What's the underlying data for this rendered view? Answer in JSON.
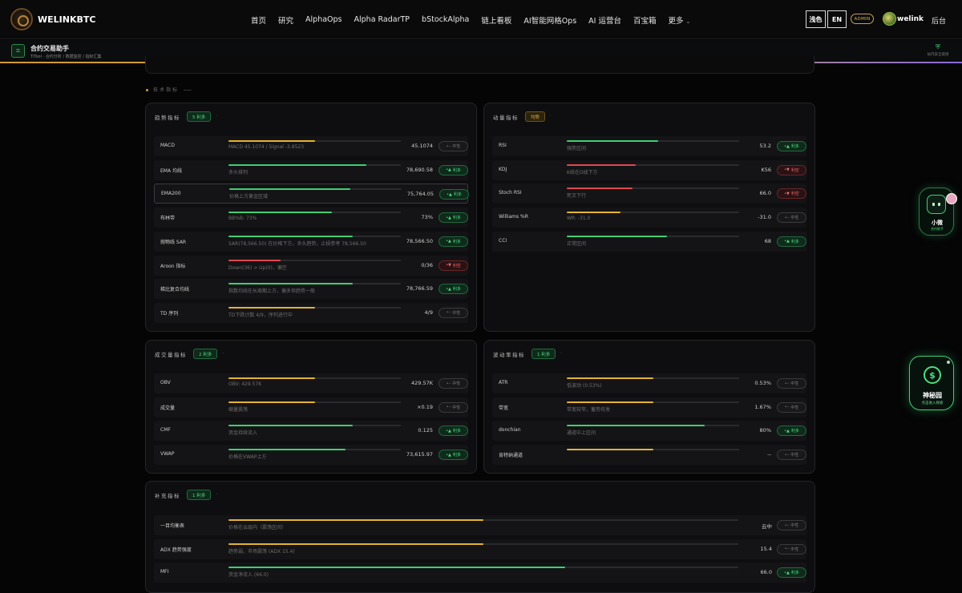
{
  "header": {
    "logo_text": "WELINKBTC",
    "nav": [
      "首页",
      "研究",
      "AlphaOps",
      "Alpha RadarTP",
      "bStockAlpha",
      "链上看板",
      "AI智能网格Ops",
      "AI 运营台",
      "百宝箱",
      "更多"
    ],
    "theme_btn": "浅色",
    "lang_btn": "EN",
    "admin_badge": "ADMIN",
    "username": "welink",
    "backend_link": "后台"
  },
  "subheader": {
    "title": "合约交易助手",
    "breadcrumb": "TiTool · 合约分析 / 数据监控 / 指标汇集",
    "secure_text": "站内安全链接"
  },
  "section_label": "技术指标",
  "cards": {
    "trend": {
      "title": "趋势指标",
      "pill": "5 利多",
      "rows": [
        {
          "name": "MACD",
          "desc": "MACD 45.1074 / Signal -3.8523",
          "value": "45.1074",
          "badge": "中性",
          "sentiment": "neutral",
          "fill": 0.5,
          "color": "#e5b32e",
          "hl": false
        },
        {
          "name": "EMA 均线",
          "desc": "多头排列",
          "value": "78,690.58",
          "badge": "利多",
          "sentiment": "bull",
          "fill": 0.8,
          "color": "#3ecf74",
          "hl": false
        },
        {
          "name": "EMA200",
          "desc": "价格上方黄金区域",
          "value": "75,764.05",
          "badge": "利多",
          "sentiment": "bull",
          "fill": 0.7,
          "color": "#3ecf74",
          "hl": true
        },
        {
          "name": "布林带",
          "desc": "BB%B: 73%",
          "value": "73%",
          "badge": "利多",
          "sentiment": "bull",
          "fill": 0.6,
          "color": "#3ecf74",
          "hl": false
        },
        {
          "name": "抛物线 SAR",
          "desc": "SAR(78,566.50) 在价格下方，多头趋势，止损参考 78,566.50",
          "value": "78,566.50",
          "badge": "利多",
          "sentiment": "bull",
          "fill": 0.72,
          "color": "#3ecf74",
          "hl": false
        },
        {
          "name": "Aroon 指标",
          "desc": "Down(36) > Up(0)，偏空",
          "value": "0/36",
          "badge": "利空",
          "sentiment": "bear",
          "fill": 0.3,
          "color": "#e0484f",
          "hl": false
        },
        {
          "name": "梯比复合均线",
          "desc": "指数均线在长周期上方，偏多但趋势一般",
          "value": "78,766.59",
          "badge": "利多",
          "sentiment": "bull",
          "fill": 0.72,
          "color": "#3ecf74",
          "hl": false
        },
        {
          "name": "TD 序列",
          "desc": "TD下跌计数 4/9，序列进行中",
          "value": "4/9",
          "badge": "中性",
          "sentiment": "neutral",
          "fill": 0.5,
          "color": "#e5b32e",
          "hl": false
        }
      ]
    },
    "momentum": {
      "title": "动量指标",
      "pill": "均势",
      "rows": [
        {
          "name": "RSI",
          "desc": "强势区间",
          "value": "53.2",
          "badge": "利多",
          "sentiment": "bull",
          "fill": 0.53,
          "color": "#3ecf74",
          "hl": false
        },
        {
          "name": "KDJ",
          "desc": "K线在D线下方",
          "value": "K56",
          "badge": "利空",
          "sentiment": "bear",
          "fill": 0.4,
          "color": "#e0484f",
          "hl": false
        },
        {
          "name": "Stoch RSI",
          "desc": "死叉下行",
          "value": "66.0",
          "badge": "利空",
          "sentiment": "bear",
          "fill": 0.38,
          "color": "#e0484f",
          "hl": false
        },
        {
          "name": "Williams %R",
          "desc": "WR: -31.0",
          "value": "-31.0",
          "badge": "中性",
          "sentiment": "neutral",
          "fill": 0.31,
          "color": "#e5b32e",
          "hl": false
        },
        {
          "name": "CCI",
          "desc": "正常区间",
          "value": "68",
          "badge": "利多",
          "sentiment": "bull",
          "fill": 0.58,
          "color": "#3ecf74",
          "hl": false
        }
      ]
    },
    "volume": {
      "title": "成交量指标",
      "pill": "2 利多",
      "rows": [
        {
          "name": "OBV",
          "desc": "OBV: 429.57K",
          "value": "429.57K",
          "badge": "中性",
          "sentiment": "neutral",
          "fill": 0.5,
          "color": "#e5b32e",
          "hl": false
        },
        {
          "name": "成交量",
          "desc": "缩量震荡",
          "value": "×0.19",
          "badge": "中性",
          "sentiment": "neutral",
          "fill": 0.5,
          "color": "#e5b32e",
          "hl": false
        },
        {
          "name": "CMF",
          "desc": "资金持续流入",
          "value": "0.125",
          "badge": "利多",
          "sentiment": "bull",
          "fill": 0.72,
          "color": "#3ecf74",
          "hl": false
        },
        {
          "name": "VWAP",
          "desc": "价格在VWAP上方",
          "value": "73,615.97",
          "badge": "利多",
          "sentiment": "bull",
          "fill": 0.68,
          "color": "#3ecf74",
          "hl": false
        }
      ]
    },
    "volatility": {
      "title": "波动率指标",
      "pill": "1 利多",
      "rows": [
        {
          "name": "ATR",
          "desc": "低波动 (0.53%)",
          "value": "0.53%",
          "badge": "中性",
          "sentiment": "neutral",
          "fill": 0.5,
          "color": "#e5b32e",
          "hl": false
        },
        {
          "name": "带宽",
          "desc": "带宽较窄，蓄势待发",
          "value": "1.67%",
          "badge": "中性",
          "sentiment": "neutral",
          "fill": 0.5,
          "color": "#e5b32e",
          "hl": false
        },
        {
          "name": "donchian",
          "desc": "通道中上区间",
          "value": "80%",
          "badge": "利多",
          "sentiment": "bull",
          "fill": 0.8,
          "color": "#3ecf74",
          "hl": false
        },
        {
          "name": "肯特纳通道",
          "desc": "",
          "value": "--",
          "badge": "中性",
          "sentiment": "neutral",
          "fill": 0.5,
          "color": "#e5b32e",
          "hl": false
        }
      ]
    },
    "supplement": {
      "title": "补充指标",
      "pill": "1 利多",
      "rows": [
        {
          "name": "一目均衡表",
          "desc": "价格在云层内（震荡区间）",
          "value": "云中",
          "badge": "中性",
          "sentiment": "neutral",
          "fill": 0.5,
          "color": "#e5b32e",
          "hl": false
        },
        {
          "name": "ADX 趋势强度",
          "desc": "趋势弱，市场震荡 (ADX 15.4)",
          "value": "15.4",
          "badge": "中性",
          "sentiment": "neutral",
          "fill": 0.5,
          "color": "#e5b32e",
          "hl": false
        },
        {
          "name": "MFI",
          "desc": "资金净流入 (66.0)",
          "value": "66.0",
          "badge": "利多",
          "sentiment": "bull",
          "fill": 0.66,
          "color": "#3ecf74",
          "hl": false
        }
      ]
    }
  },
  "floating": {
    "assistant_name": "小微",
    "assistant_sub": "合约助手",
    "garden_name": "神秘园",
    "garden_sub": "点击进入探索"
  }
}
